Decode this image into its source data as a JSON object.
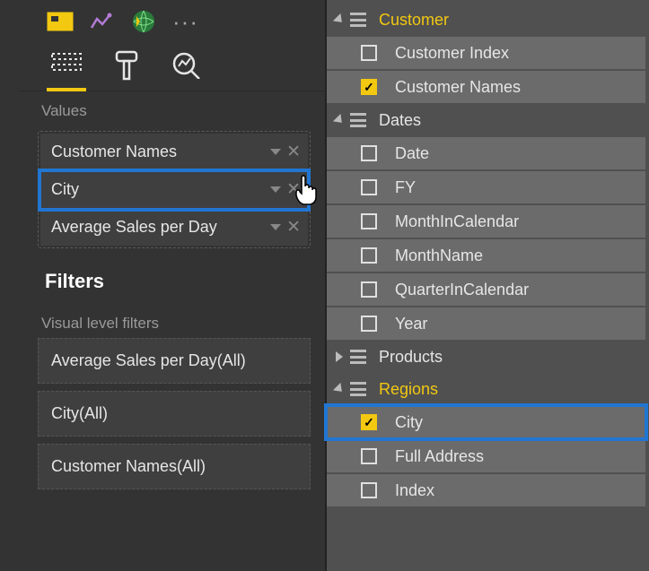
{
  "sections": {
    "values_label": "Values",
    "filters_title": "Filters",
    "visual_filters_label": "Visual level filters"
  },
  "values": [
    {
      "label": "Customer Names"
    },
    {
      "label": "City",
      "highlighted": true
    },
    {
      "label": "Average Sales per Day"
    }
  ],
  "filters": [
    {
      "label": "Average Sales per Day(All)"
    },
    {
      "label": "City(All)"
    },
    {
      "label": "Customer Names(All)"
    }
  ],
  "fields": {
    "tables": [
      {
        "name": "Customer",
        "expanded": true,
        "accent": true,
        "columns": [
          {
            "name": "Customer Index",
            "checked": false
          },
          {
            "name": "Customer Names",
            "checked": true
          }
        ]
      },
      {
        "name": "Dates",
        "expanded": true,
        "accent": false,
        "columns": [
          {
            "name": "Date",
            "checked": false
          },
          {
            "name": "FY",
            "checked": false
          },
          {
            "name": "MonthInCalendar",
            "checked": false
          },
          {
            "name": "MonthName",
            "checked": false
          },
          {
            "name": "QuarterInCalendar",
            "checked": false
          },
          {
            "name": "Year",
            "checked": false
          }
        ]
      },
      {
        "name": "Products",
        "expanded": false,
        "accent": false,
        "columns": []
      },
      {
        "name": "Regions",
        "expanded": true,
        "accent": true,
        "columns": [
          {
            "name": "City",
            "checked": true,
            "highlighted": true
          },
          {
            "name": "Full Address",
            "checked": false
          },
          {
            "name": "Index",
            "checked": false
          }
        ]
      }
    ]
  },
  "ellipsis": "···",
  "checkmark": "✓"
}
